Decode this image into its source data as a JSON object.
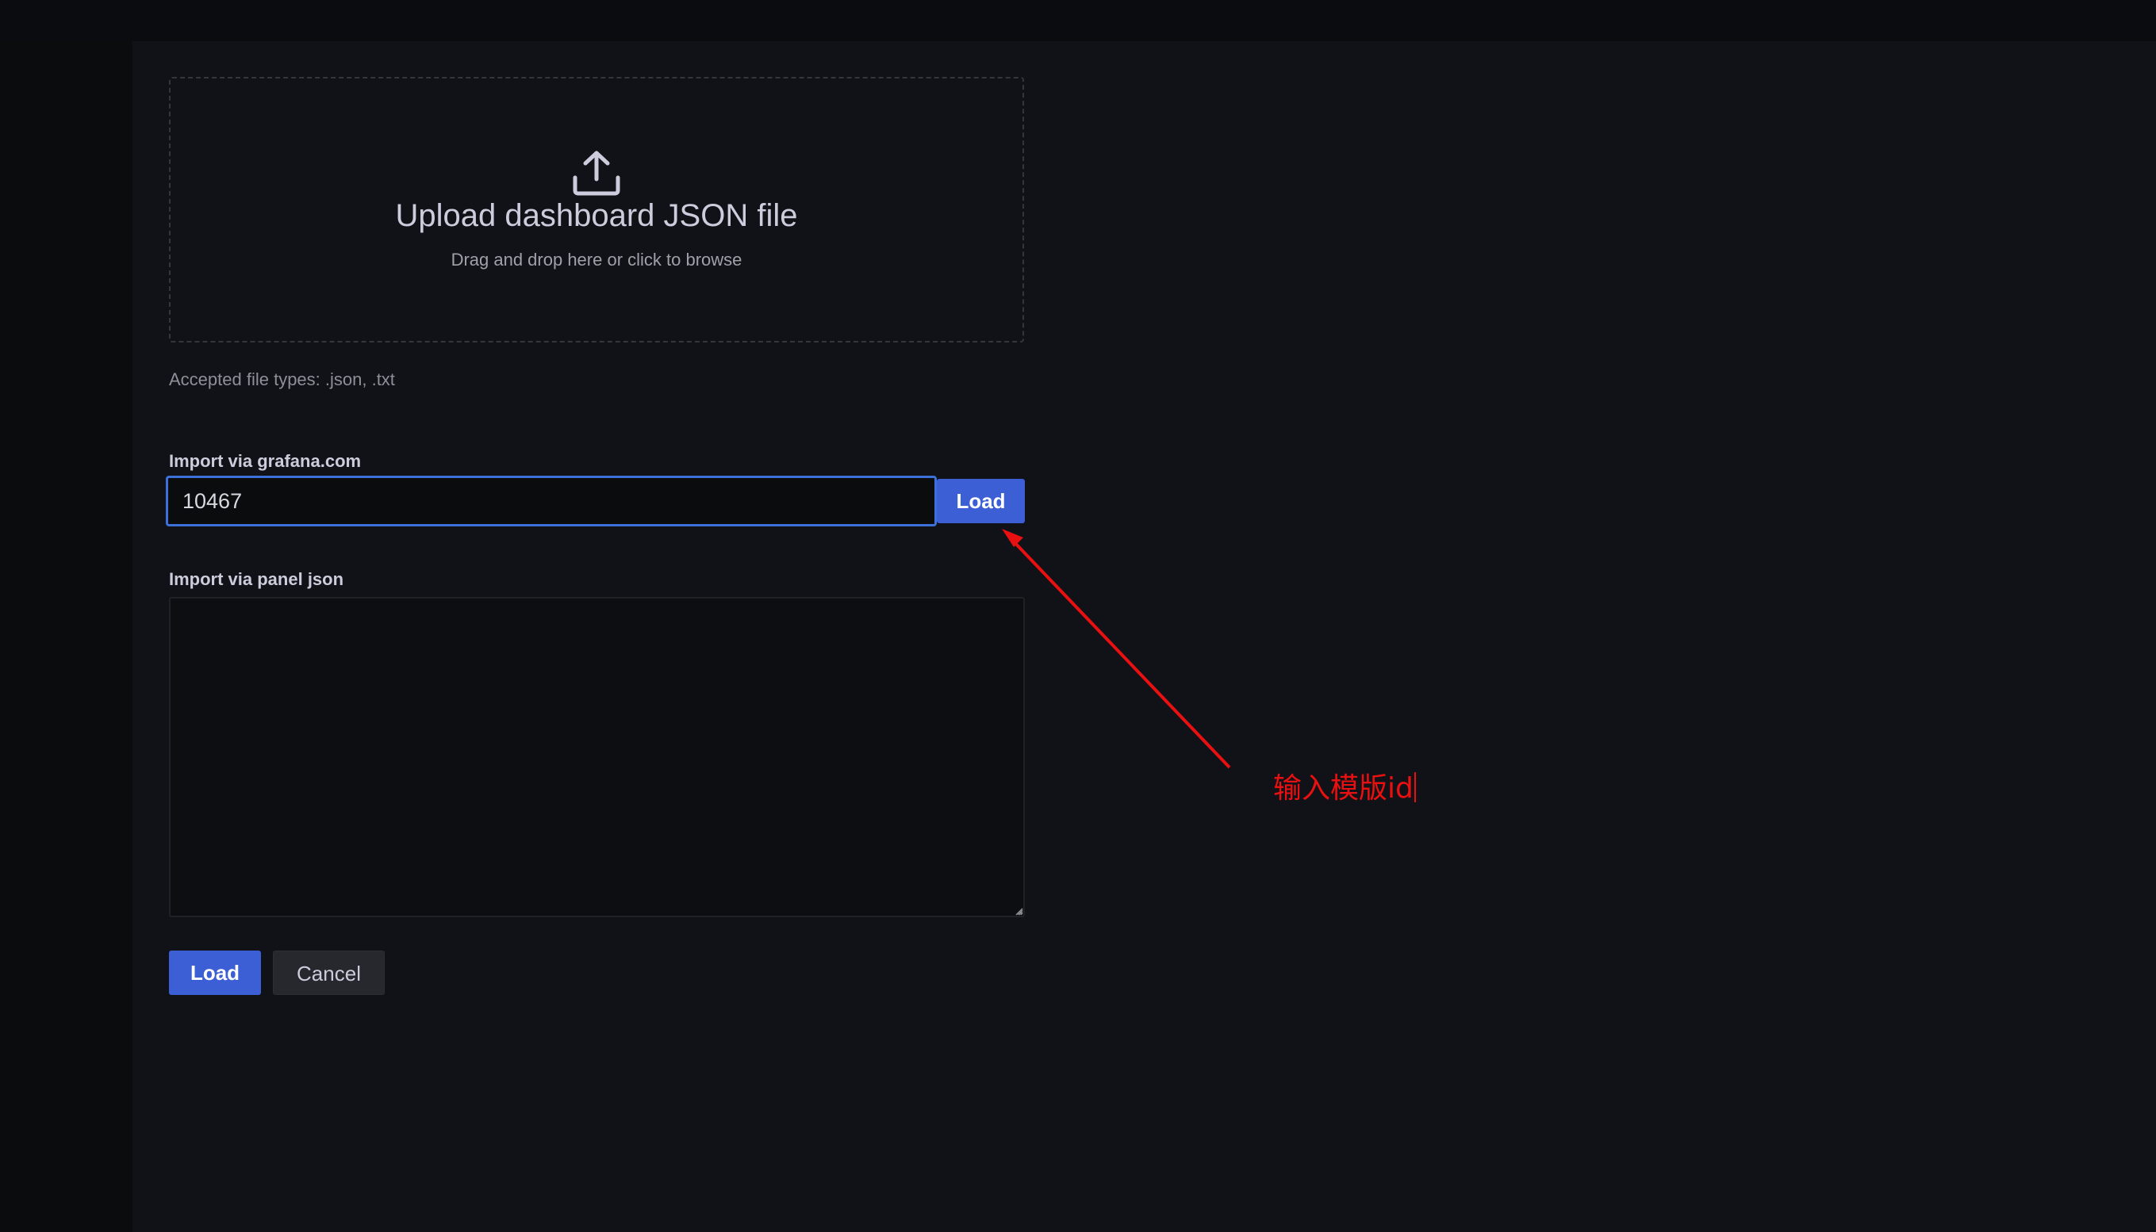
{
  "upload": {
    "title": "Upload dashboard JSON file",
    "subtitle": "Drag and drop here or click to browse",
    "icon": "upload-icon",
    "accepted_types": "Accepted file types: .json, .txt"
  },
  "grafana_import": {
    "label": "Import via grafana.com",
    "value": "10467",
    "load_label": "Load"
  },
  "panel_json": {
    "label": "Import via panel json",
    "value": ""
  },
  "actions": {
    "load_label": "Load",
    "cancel_label": "Cancel"
  },
  "annotation": {
    "text": "输入模版id",
    "color": "#e81010"
  },
  "colors": {
    "primary": "#3d5fd6",
    "focus_border": "#3d71d9",
    "background": "#111217"
  }
}
